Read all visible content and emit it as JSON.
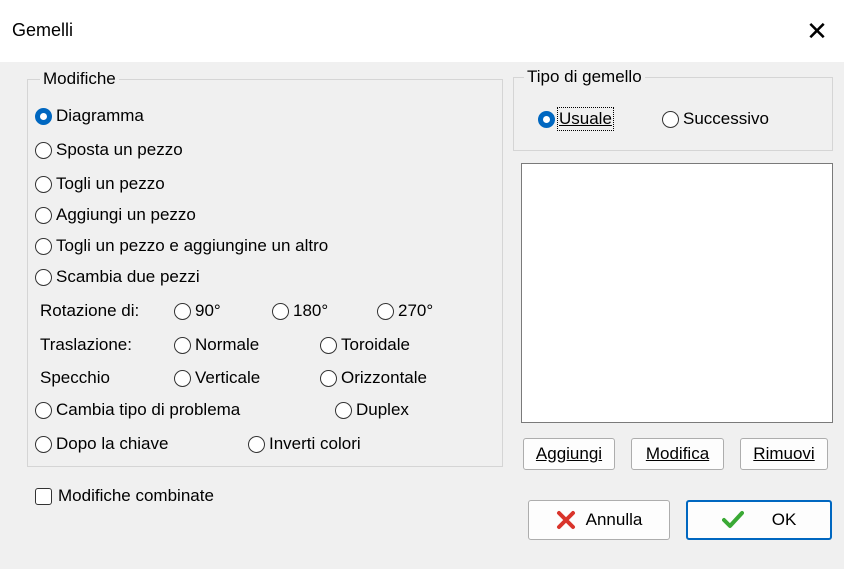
{
  "window": {
    "title": "Gemelli",
    "close_glyph": "✕"
  },
  "modifiche": {
    "legend": "Modifiche",
    "options": [
      {
        "label": "Diagramma",
        "checked": true
      },
      {
        "label": "Sposta un pezzo"
      },
      {
        "label": "Togli un pezzo"
      },
      {
        "label": "Aggiungi un pezzo"
      },
      {
        "label": "Togli un pezzo e aggiungine un altro"
      },
      {
        "label": "Scambia due pezzi"
      }
    ],
    "rotazione": {
      "label": "Rotazione di:",
      "options": [
        "90°",
        "180°",
        "270°"
      ]
    },
    "traslazione": {
      "label": "Traslazione:",
      "options": [
        "Normale",
        "Toroidale"
      ]
    },
    "specchio": {
      "label": "Specchio",
      "options": [
        "Verticale",
        "Orizzontale"
      ]
    },
    "cambia": "Cambia tipo di problema",
    "duplex": "Duplex",
    "dopo_chiave": "Dopo la chiave",
    "inverti": "Inverti colori"
  },
  "combinate": {
    "label": "Modifiche combinate",
    "checked": false
  },
  "tipo": {
    "legend": "Tipo di gemello",
    "options": [
      {
        "label": "Usuale",
        "checked": true
      },
      {
        "label": "Successivo"
      }
    ]
  },
  "list_buttons": {
    "aggiungi": "Aggiungi",
    "modifica": "Modifica",
    "rimuovi": "Rimuovi"
  },
  "footer": {
    "annulla": "Annulla",
    "ok": "OK"
  },
  "colors": {
    "accent": "#0067c0",
    "cancel_icon": "#d9342b",
    "ok_icon": "#3aa935"
  },
  "icons": {
    "cancel": "cross-icon",
    "ok": "check-icon"
  }
}
